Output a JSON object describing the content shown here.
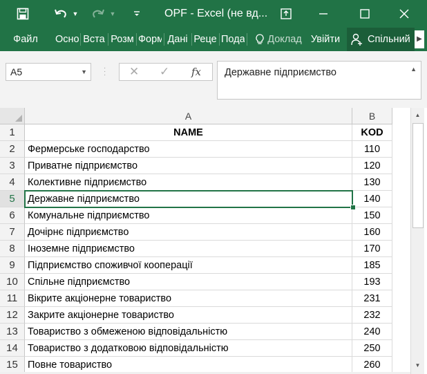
{
  "titlebar": {
    "title": "OPF - Excel (не вд...",
    "accent": "#217346"
  },
  "ribbon": {
    "file": "Файл",
    "tabs": [
      "Осно",
      "Вста",
      "Розм",
      "Форм",
      "Дані",
      "Реце",
      "Подал"
    ],
    "tell_me": "Доклад",
    "sign_in": "Увійти",
    "share": "Спільний"
  },
  "formula_bar": {
    "name_box": "A5",
    "formula": "Державне підприємство"
  },
  "sheet": {
    "columns": [
      "A",
      "B"
    ],
    "header": {
      "name": "NAME",
      "kod": "KOD"
    },
    "rows": [
      {
        "num": "2",
        "name": "Фермерське господарство",
        "kod": "110"
      },
      {
        "num": "3",
        "name": "Приватне підприємство",
        "kod": "120"
      },
      {
        "num": "4",
        "name": "Колективне підприємство",
        "kod": "130"
      },
      {
        "num": "5",
        "name": "Державне підприємство",
        "kod": "140"
      },
      {
        "num": "6",
        "name": "Комунальне підприємство",
        "kod": "150"
      },
      {
        "num": "7",
        "name": "Дочірнє підприємство",
        "kod": "160"
      },
      {
        "num": "8",
        "name": "Іноземне підприємство",
        "kod": "170"
      },
      {
        "num": "9",
        "name": "Підприємство споживчої кооперації",
        "kod": "185"
      },
      {
        "num": "10",
        "name": "Спільне підприємство",
        "kod": "193"
      },
      {
        "num": "11",
        "name": "Вікрите акціонерне товариство",
        "kod": "231"
      },
      {
        "num": "12",
        "name": "Закрите акціонерне товариство",
        "kod": "232"
      },
      {
        "num": "13",
        "name": "Товариство з обмеженою відповідальністю",
        "kod": "240"
      },
      {
        "num": "14",
        "name": "Товариство з додатковою відповідальністю",
        "kod": "250"
      },
      {
        "num": "15",
        "name": "Повне товариство",
        "kod": "260"
      }
    ],
    "active_row": "5"
  }
}
